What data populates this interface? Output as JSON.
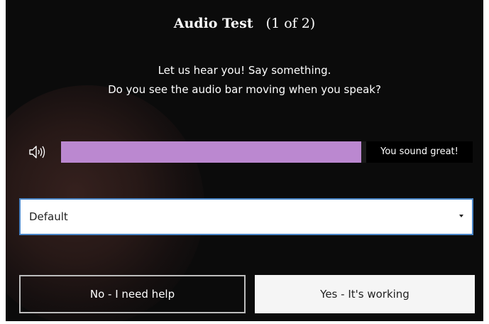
{
  "dialog": {
    "title": "Audio Test",
    "step": "(1 of 2)",
    "instructions": [
      "Let us hear you! Say something.",
      "Do you see the audio bar moving when you speak?"
    ]
  },
  "audio_meter": {
    "icon": "speaker-icon",
    "level_fraction": 0.98,
    "fill_color": "#bb88d0",
    "status": "You sound great!"
  },
  "device_select": {
    "selected": "Default"
  },
  "buttons": {
    "no_label": "No - I need help",
    "yes_label": "Yes - It's working"
  }
}
